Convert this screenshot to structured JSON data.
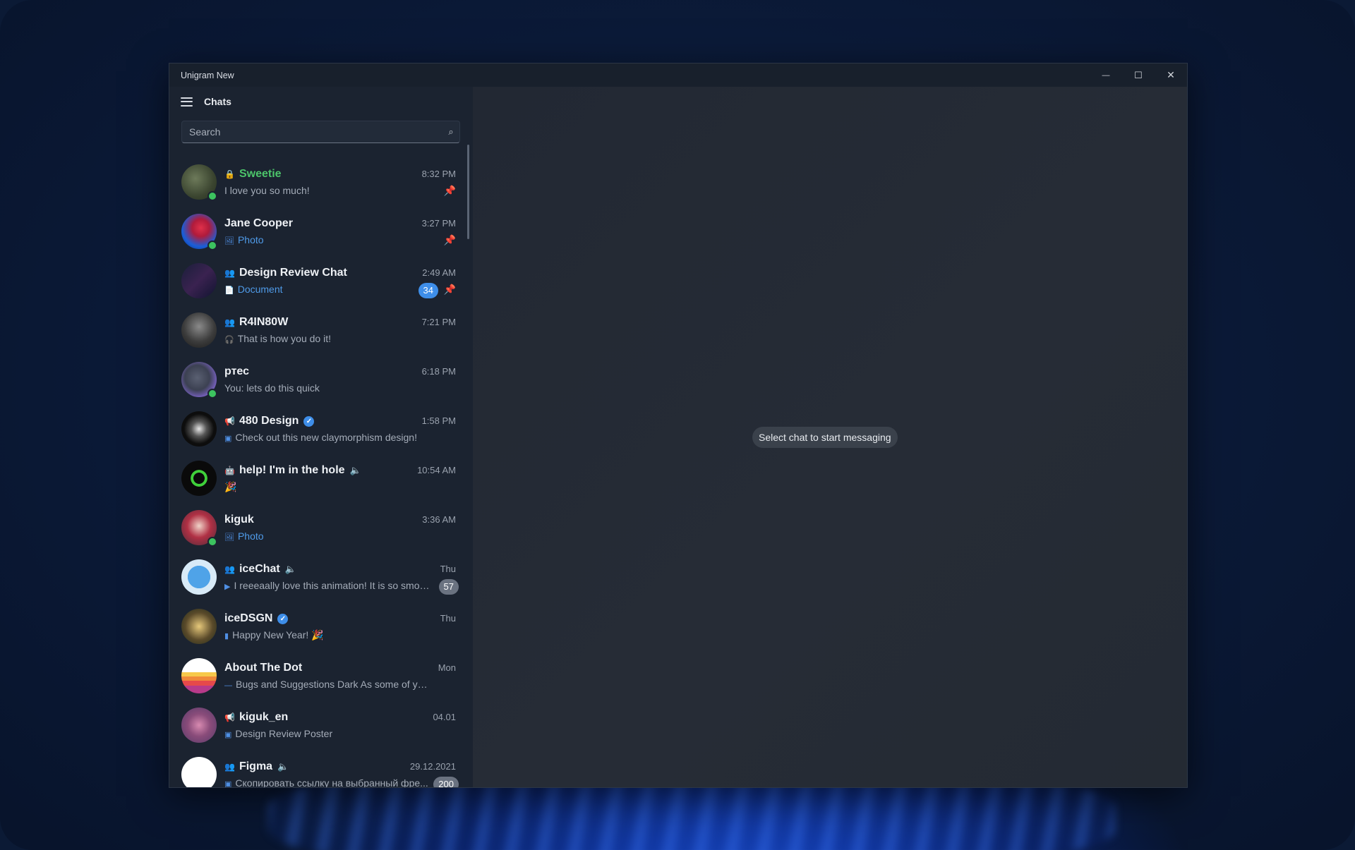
{
  "window": {
    "title": "Unigram New",
    "controls": {
      "minimize": "—",
      "maximize": "☐",
      "close": "✕"
    }
  },
  "header": {
    "title": "Chats"
  },
  "search": {
    "placeholder": "Search"
  },
  "empty_state": {
    "text": "Select chat to start messaging"
  },
  "chats": [
    {
      "name": "Sweetie",
      "name_color": "#4cc46a",
      "type_icon": "lock-icon",
      "preview": "I love you so much!",
      "time": "8:32 PM",
      "pinned": true,
      "online": true
    },
    {
      "name": "Jane Cooper",
      "preview_icon": "photo-icon",
      "preview": "Photo",
      "preview_blue": true,
      "time": "3:27 PM",
      "pinned": true,
      "online": true
    },
    {
      "name": "Design Review Chat",
      "type_icon": "group-icon",
      "preview_icon": "document-icon",
      "preview": "Document",
      "preview_blue": true,
      "time": "2:49 AM",
      "pinned": true,
      "unread": "34"
    },
    {
      "name": "R4IN80W",
      "type_icon": "group-icon",
      "preview_icon": "headphones-icon",
      "preview": "That is how you do it!",
      "time": "7:21 PM"
    },
    {
      "name": "ртес",
      "preview": "You: lets do this quick",
      "time": "6:18 PM",
      "online": true
    },
    {
      "name": "480 Design",
      "type_icon": "channel-icon",
      "verified": true,
      "preview_icon": "image-icon",
      "preview": "Check out this new claymorphism design!",
      "time": "1:58 PM"
    },
    {
      "name": "help! I'm in the hole",
      "type_icon": "bot-icon",
      "muted": true,
      "preview": "🎉",
      "time": "10:54 AM"
    },
    {
      "name": "kiguk",
      "preview_icon": "photo-icon",
      "preview": "Photo",
      "preview_blue": true,
      "time": "3:36 AM",
      "online": true
    },
    {
      "name": "iceChat",
      "type_icon": "group-icon",
      "muted": true,
      "preview_icon": "video-icon",
      "preview": "I reeeaally love this animation! It is so smot...",
      "time": "Thu",
      "unread_muted": "57"
    },
    {
      "name": "iceDSGN",
      "verified": true,
      "preview_icon": "chart-icon",
      "preview": "Happy New Year! 🎉",
      "time": "Thu"
    },
    {
      "name": "About The Dot",
      "preview_icon": "dash-icon",
      "preview": "Bugs and Suggestions Dark As some of you are ...",
      "time": "Mon"
    },
    {
      "name": "kiguk_en",
      "type_icon": "channel-icon",
      "preview_icon": "image-icon",
      "preview": "Design Review Poster",
      "time": "04.01"
    },
    {
      "name": "Figma",
      "type_icon": "group-icon",
      "muted": true,
      "preview_icon": "image-icon",
      "preview": "Скопировать ссылку на выбранный фре...",
      "time": "29.12.2021",
      "unread_muted": "200"
    }
  ]
}
